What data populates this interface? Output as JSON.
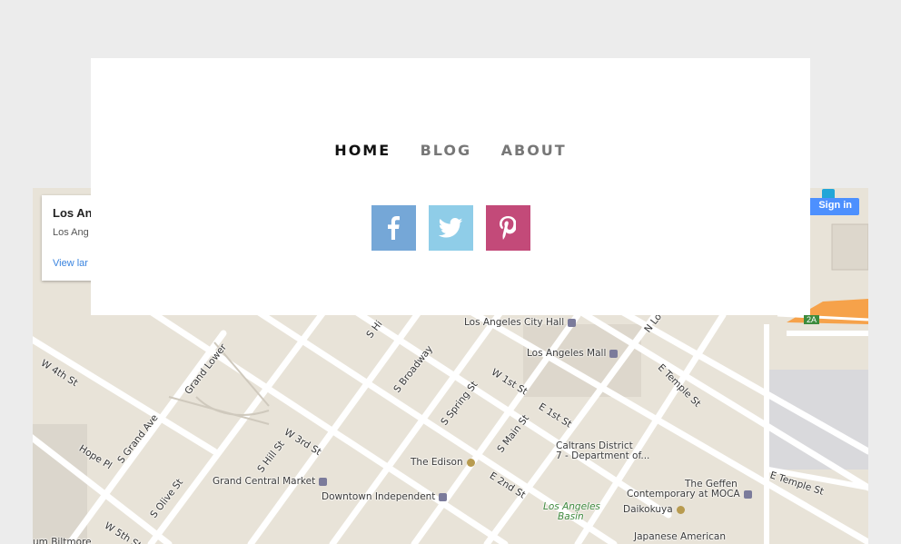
{
  "nav": {
    "items": [
      {
        "label": "HOME",
        "active": true
      },
      {
        "label": "BLOG",
        "active": false
      },
      {
        "label": "ABOUT",
        "active": false
      }
    ]
  },
  "social": [
    {
      "name": "facebook",
      "icon": "facebook-icon",
      "color": "#75a7d7"
    },
    {
      "name": "twitter",
      "icon": "twitter-icon",
      "color": "#8fcde8"
    },
    {
      "name": "pinterest",
      "icon": "pinterest-icon",
      "color": "#c34a79"
    }
  ],
  "map": {
    "info_card": {
      "title": "Los An",
      "address": "Los Ang",
      "link": "View lar"
    },
    "signin_label": "Sign in",
    "exit_label": "2A",
    "streets": {
      "w_4th": "W 4th St",
      "grand_lower": "Grand Lower",
      "s_grand_ave": "S Grand Ave",
      "hope_pl": "Hope Pl",
      "s_olive": "S Olive St",
      "w_5th": "W 5th St",
      "s_hill": "S Hill St",
      "w_3rd": "W 3rd St",
      "s_broadway": "S Broadway",
      "s_spring": "S Spring St",
      "w_1st": "W 1st St",
      "e_1st": "E 1st St",
      "s_main": "S Main St",
      "e_2nd": "E 2nd St",
      "e_temple": "E Temple St",
      "e_temple_2": "E Temple St",
      "s_hi": "S Hi",
      "n_lo": "N Lo"
    },
    "places": {
      "city_hall": "Los Angeles City Hall",
      "la_mall": "Los Angeles Mall",
      "caltrans_1": "Caltrans District",
      "caltrans_2": "7 - Department of...",
      "edison": "The Edison",
      "grand_central": "Grand Central Market",
      "downtown_indep": "Downtown Independent",
      "geffen_1": "The Geffen",
      "geffen_2": "Contemporary at MOCA",
      "daikokuya": "Daikokuya",
      "jam_1": "Japanese American",
      "la_basin_1": "Los Angeles",
      "la_basin_2": "Basin",
      "biltmore": "um Biltmore"
    }
  }
}
